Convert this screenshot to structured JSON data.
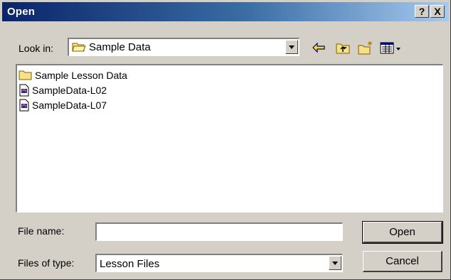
{
  "window": {
    "title": "Open",
    "help_label": "?",
    "close_label": "X"
  },
  "look_in": {
    "label": "Look in:",
    "value": "Sample Data"
  },
  "toolbar": [
    {
      "icon": "back-arrow-icon"
    },
    {
      "icon": "up-folder-icon"
    },
    {
      "icon": "new-folder-icon"
    },
    {
      "icon": "view-menu-icon"
    }
  ],
  "files": [
    {
      "name": "Sample Lesson Data",
      "icon": "folder-icon"
    },
    {
      "name": "SampleData-L02",
      "icon": "lesson-file-icon"
    },
    {
      "name": "SampleData-L07",
      "icon": "lesson-file-icon"
    }
  ],
  "file_name": {
    "label": "File name:",
    "value": ""
  },
  "file_type": {
    "label": "Files of type:",
    "value": "Lesson Files"
  },
  "buttons": {
    "open": "Open",
    "cancel": "Cancel"
  },
  "colors": {
    "title_start": "#0a246a",
    "title_end": "#a6caf0",
    "face": "#d4d0c8"
  }
}
